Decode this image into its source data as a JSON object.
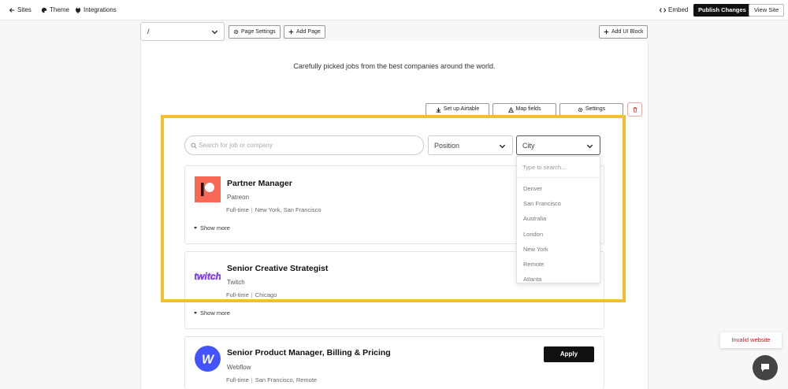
{
  "topnav": {
    "sites": "Sites",
    "theme": "Theme",
    "integrations": "Integrations",
    "embed": "Embed",
    "publish": "Publish Changes",
    "view_site": "View Site"
  },
  "toolbar": {
    "page_path": "/",
    "page_settings": "Page Settings",
    "add_page": "Add Page",
    "add_ui_block": "Add UI Block"
  },
  "hero": {
    "subtitle": "Carefully picked jobs from the best companies around the world."
  },
  "block_actions": {
    "setup_airtable": "Set up Airtable",
    "map_fields": "Map fields",
    "settings": "Settings"
  },
  "filters": {
    "search_placeholder": "Search for job or company",
    "position": "Position",
    "city": "City"
  },
  "city_dropdown": {
    "search_placeholder": "Type to search...",
    "options": [
      "Denver",
      "San Francisco",
      "Australia",
      "London",
      "New York",
      "Remote",
      "Atlanta"
    ]
  },
  "jobs": [
    {
      "title": "Partner Manager",
      "company": "Patreon",
      "type": "Full-time",
      "location": "New York, San Francisco",
      "show_more": "Show more"
    },
    {
      "title": "Senior Creative Strategist",
      "company": "Twitch",
      "type": "Full-time",
      "location": "Chicago",
      "show_more": "Show more",
      "logo_text": "twitch"
    },
    {
      "title": "Senior Product Manager, Billing & Pricing",
      "company": "Webflow",
      "type": "Full-time",
      "location": "San Francisco, Remote",
      "apply": "Apply",
      "logo_text": "W"
    }
  ],
  "misc": {
    "invalid_website": "Invalid website"
  },
  "colors": {
    "highlight": "#f0c030",
    "patreon": "#f96854",
    "twitch": "#9146ff",
    "webflow": "#4353ff"
  }
}
